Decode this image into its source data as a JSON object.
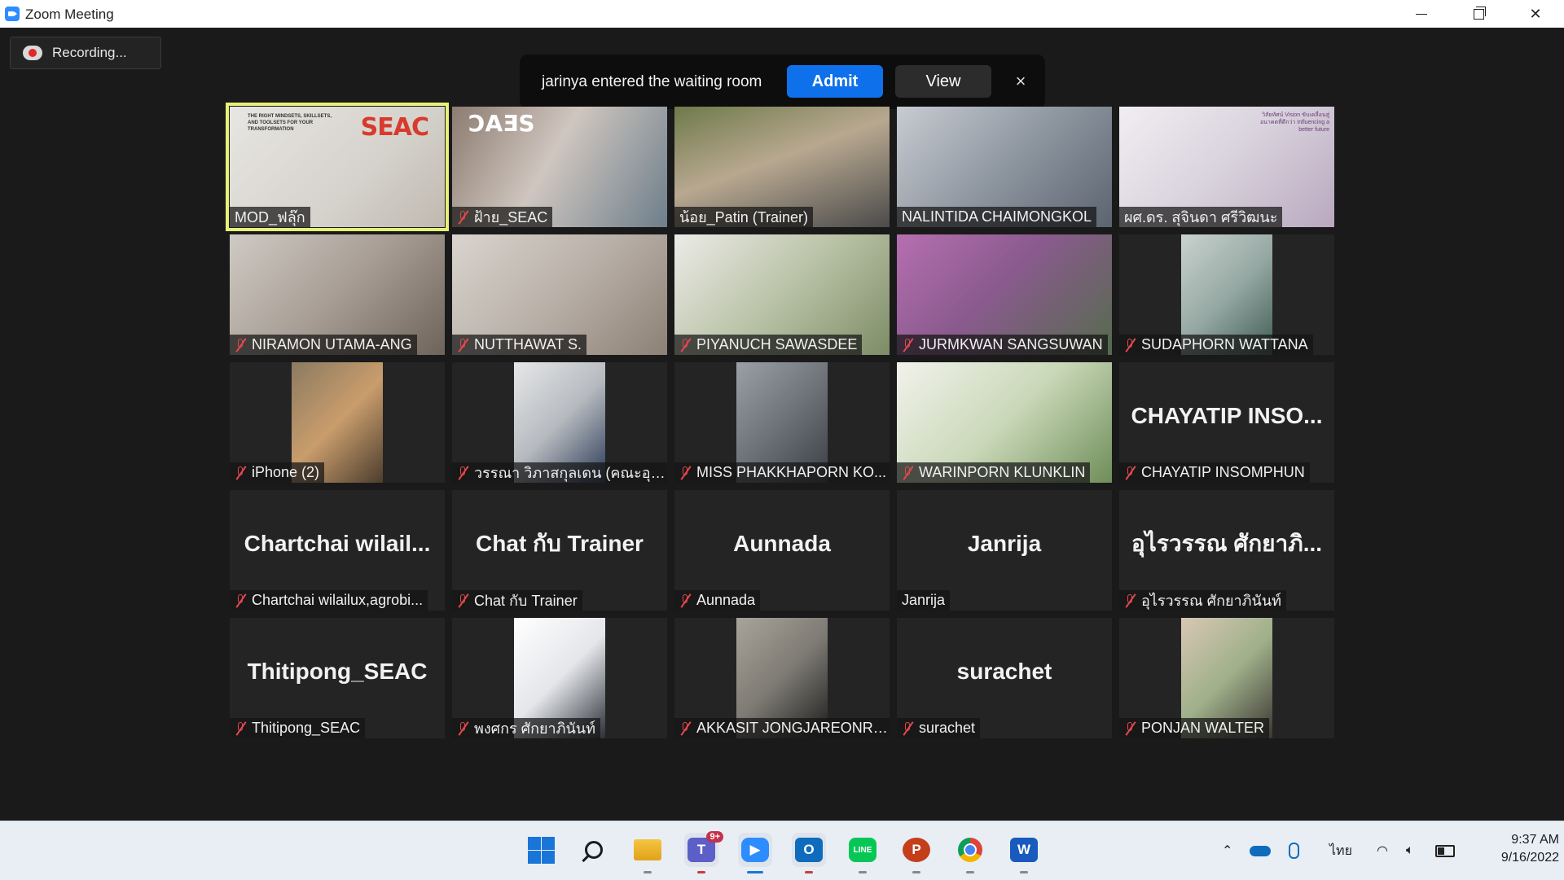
{
  "window": {
    "title": "Zoom Meeting"
  },
  "recording": {
    "label": "Recording..."
  },
  "waiting_room": {
    "message": "jarinya entered the waiting room",
    "admit_label": "Admit",
    "view_label": "View",
    "close_glyph": "×"
  },
  "participants": [
    {
      "name": "MOD_ฟลุ๊ก",
      "muted": false,
      "video": true,
      "active": true
    },
    {
      "name": "ฝ้าย_SEAC",
      "muted": true,
      "video": true
    },
    {
      "name": "น้อย_Patin (Trainer)",
      "muted": false,
      "video": true,
      "speaking": true
    },
    {
      "name": "NALINTIDA CHAIMONGKOL",
      "muted": false,
      "video": true
    },
    {
      "name": "ผศ.ดร. สุจินดา ศรีวิฒนะ",
      "muted": false,
      "video": true
    },
    {
      "name": "NIRAMON UTAMA-ANG",
      "muted": true,
      "video": true
    },
    {
      "name": "NUTTHAWAT S.",
      "muted": true,
      "video": true
    },
    {
      "name": "PIYANUCH SAWASDEE",
      "muted": true,
      "video": true
    },
    {
      "name": "JURMKWAN SANGSUWAN",
      "muted": true,
      "video": true
    },
    {
      "name": "SUDAPHORN WATTANA",
      "muted": true,
      "video": true,
      "portrait": true
    },
    {
      "name": "iPhone (2)",
      "muted": true,
      "video": true,
      "portrait": true
    },
    {
      "name": "วรรณา วิภาสกุลเดน (คณะอุต...",
      "muted": true,
      "video": true,
      "portrait": true
    },
    {
      "name": "MISS PHAKKHAPORN KO...",
      "muted": true,
      "video": true,
      "portrait": true
    },
    {
      "name": "WARINPORN KLUNKLIN",
      "muted": true,
      "video": true
    },
    {
      "name": "CHAYATIP INSOMPHUN",
      "big": "CHAYATIP  INSO...",
      "muted": true,
      "video": false
    },
    {
      "name": "Chartchai wilailux,agrobi...",
      "big": "Chartchai  wilail...",
      "muted": true,
      "video": false
    },
    {
      "name": "Chat กับ Trainer",
      "big": "Chat กับ Trainer",
      "muted": true,
      "video": false
    },
    {
      "name": "Aunnada",
      "big": "Aunnada",
      "muted": true,
      "video": false
    },
    {
      "name": "Janrija",
      "big": "Janrija",
      "muted": false,
      "video": false
    },
    {
      "name": "อุไรวรรณ ศักยาภินันท์",
      "big": "อุไรวรรณ  ศักยาภิ...",
      "muted": true,
      "video": false
    },
    {
      "name": "Thitipong_SEAC",
      "big": "Thitipong_SEAC",
      "muted": true,
      "video": false
    },
    {
      "name": "พงศกร ศักยาภินันท์",
      "muted": true,
      "video": true,
      "portrait": true
    },
    {
      "name": "AKKASIT JONGJAREONRAK",
      "muted": true,
      "video": true,
      "portrait": true
    },
    {
      "name": "surachet",
      "big": "surachet",
      "muted": true,
      "video": false
    },
    {
      "name": "PONJAN WALTER",
      "muted": true,
      "video": true,
      "portrait": true
    }
  ],
  "video_overlays": {
    "mod_brand": "SEAC",
    "mod_tagline": "THE RIGHT MINDSETS, SKILLSETS, AND TOOLSETS FOR YOUR TRANSFORMATION",
    "faay_brand": "SEAC mirrored",
    "sujinda_banner": "วิสัยทัศน์ Vision ขับเคลื่อนสู่อนาคตที่ดีกว่า Influencing a better future"
  },
  "taskbar": {
    "apps": [
      "start-icon",
      "search-icon",
      "file-explorer-icon",
      "teams-icon",
      "zoom-icon",
      "outlook-icon",
      "line-icon",
      "powerpoint-icon",
      "chrome-icon",
      "word-icon"
    ],
    "teams_badge": "9+",
    "tray_language": "ไทย",
    "time": "9:37 AM",
    "date": "9/16/2022"
  },
  "colors": {
    "admit": "#0e71eb",
    "active_border": "#e8f07a",
    "muted_mic": "#e5484d",
    "recording_dot": "#e02828"
  }
}
